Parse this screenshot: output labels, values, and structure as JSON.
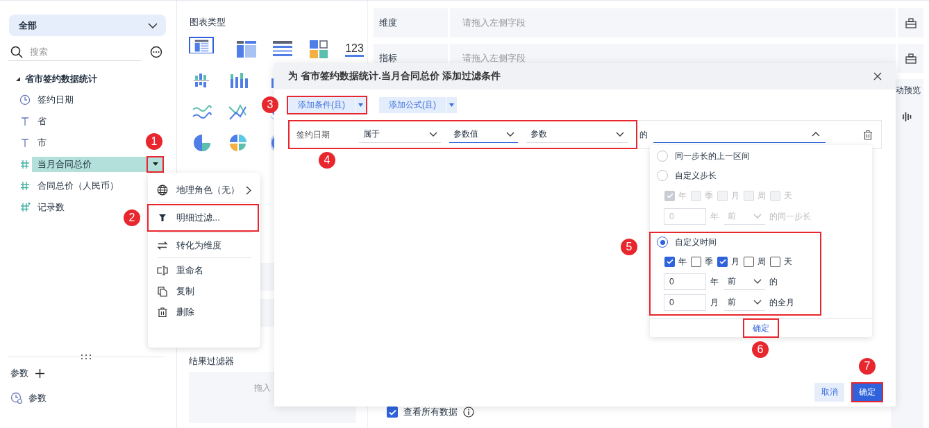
{
  "sidebar": {
    "scope": "全部",
    "search_placeholder": "搜索",
    "tree": {
      "label": "省市签约数据统计",
      "expanded": true,
      "children": [
        {
          "label": "签约日期",
          "kind": "date",
          "selected": false
        },
        {
          "label": "省",
          "kind": "text",
          "selected": false
        },
        {
          "label": "市",
          "kind": "text",
          "selected": false
        },
        {
          "label": "当月合同总价",
          "kind": "number",
          "selected": true,
          "highlighted": true,
          "callout": "1"
        },
        {
          "label": "合同总价（人民币）",
          "kind": "number",
          "selected": false
        },
        {
          "label": "记录数",
          "kind": "count",
          "selected": false
        }
      ]
    },
    "params_title": "参数",
    "params": [
      {
        "label": "参数"
      }
    ]
  },
  "field_menu": [
    {
      "label": "地理角色（无）",
      "kind": "geo",
      "submenu": true,
      "divider_after": true
    },
    {
      "label": "明细过滤...",
      "kind": "filter",
      "submenu": false,
      "divider_after": true,
      "highlighted": true,
      "callout": "2"
    },
    {
      "label": "转化为维度",
      "kind": "convert",
      "submenu": false,
      "divider_after": true
    },
    {
      "label": "重命名",
      "kind": "rename",
      "submenu": false,
      "divider_after": false
    },
    {
      "label": "复制",
      "kind": "copy",
      "submenu": false,
      "divider_after": false
    },
    {
      "label": "删除",
      "kind": "delete",
      "submenu": false,
      "divider_after": false
    }
  ],
  "chart_panel": {
    "title": "图表类型",
    "rows": [
      [
        {
          "kind": "table",
          "selected": true
        },
        {
          "kind": "cross-table",
          "selected": false
        },
        {
          "kind": "detail-table",
          "selected": false
        },
        {
          "kind": "tiles",
          "selected": false
        },
        {
          "kind": "number",
          "label": "123",
          "selected": false
        }
      ],
      [
        {
          "kind": "grouped-bar",
          "selected": false
        },
        {
          "kind": "stacked-bar",
          "selected": false
        },
        {
          "kind": "bar",
          "selected": false
        }
      ],
      [
        {
          "kind": "area",
          "selected": false
        },
        {
          "kind": "line",
          "selected": false
        },
        {
          "kind": "radar",
          "selected": false
        }
      ],
      [
        {
          "kind": "pie",
          "selected": false
        },
        {
          "kind": "rose",
          "selected": false
        },
        {
          "kind": "ring",
          "selected": false
        }
      ]
    ],
    "result_filter": {
      "title": "结果过滤器",
      "hint": "拖入"
    }
  },
  "shelves": [
    {
      "label": "维度",
      "placeholder": "请拖入左侧字段"
    },
    {
      "label": "指标",
      "placeholder": "请拖入左侧字段"
    }
  ],
  "preview_label": "动预览",
  "view_all": {
    "label": "查看所有数据",
    "checked": true
  },
  "dialog": {
    "title": "为 省市签约数据统计.当月合同总价 添加过滤条件",
    "add_buttons": [
      {
        "label": "添加条件(且)",
        "highlighted": true,
        "callout": "3"
      },
      {
        "label": "添加公式(且)"
      }
    ],
    "condition": {
      "field": "签约日期",
      "operator": "属于",
      "value_type": "参数值",
      "value": "参数",
      "connector": "的",
      "highlighted": true,
      "callout": "4",
      "picker_expanded": true
    },
    "picker": {
      "options": [
        {
          "label": "同一步长的上一区间",
          "kind": "plain",
          "selected": false
        },
        {
          "label": "自定义步长",
          "kind": "custom",
          "selected": false,
          "disabled": true,
          "units": [
            {
              "label": "年",
              "checked": true
            },
            {
              "label": "季",
              "checked": false
            },
            {
              "label": "月",
              "checked": false
            },
            {
              "label": "周",
              "checked": false
            },
            {
              "label": "天",
              "checked": false
            }
          ],
          "offsets": [
            {
              "value": "0",
              "unit": "年",
              "direction": "前",
              "suffix": "的同一步长"
            }
          ]
        },
        {
          "label": "自定义时间",
          "kind": "custom",
          "selected": true,
          "disabled": false,
          "highlighted": true,
          "callout": "5",
          "units": [
            {
              "label": "年",
              "checked": true
            },
            {
              "label": "季",
              "checked": false
            },
            {
              "label": "月",
              "checked": true
            },
            {
              "label": "周",
              "checked": false
            },
            {
              "label": "天",
              "checked": false
            }
          ],
          "offsets": [
            {
              "value": "0",
              "unit": "年",
              "direction": "前",
              "suffix": "的"
            },
            {
              "value": "0",
              "unit": "月",
              "direction": "前",
              "suffix": "的全月"
            }
          ]
        }
      ],
      "confirm": {
        "label": "确定",
        "highlighted": true,
        "callout": "6"
      }
    },
    "cancel": {
      "label": "取消"
    },
    "ok": {
      "label": "确定",
      "highlighted": true,
      "callout": "7"
    }
  }
}
